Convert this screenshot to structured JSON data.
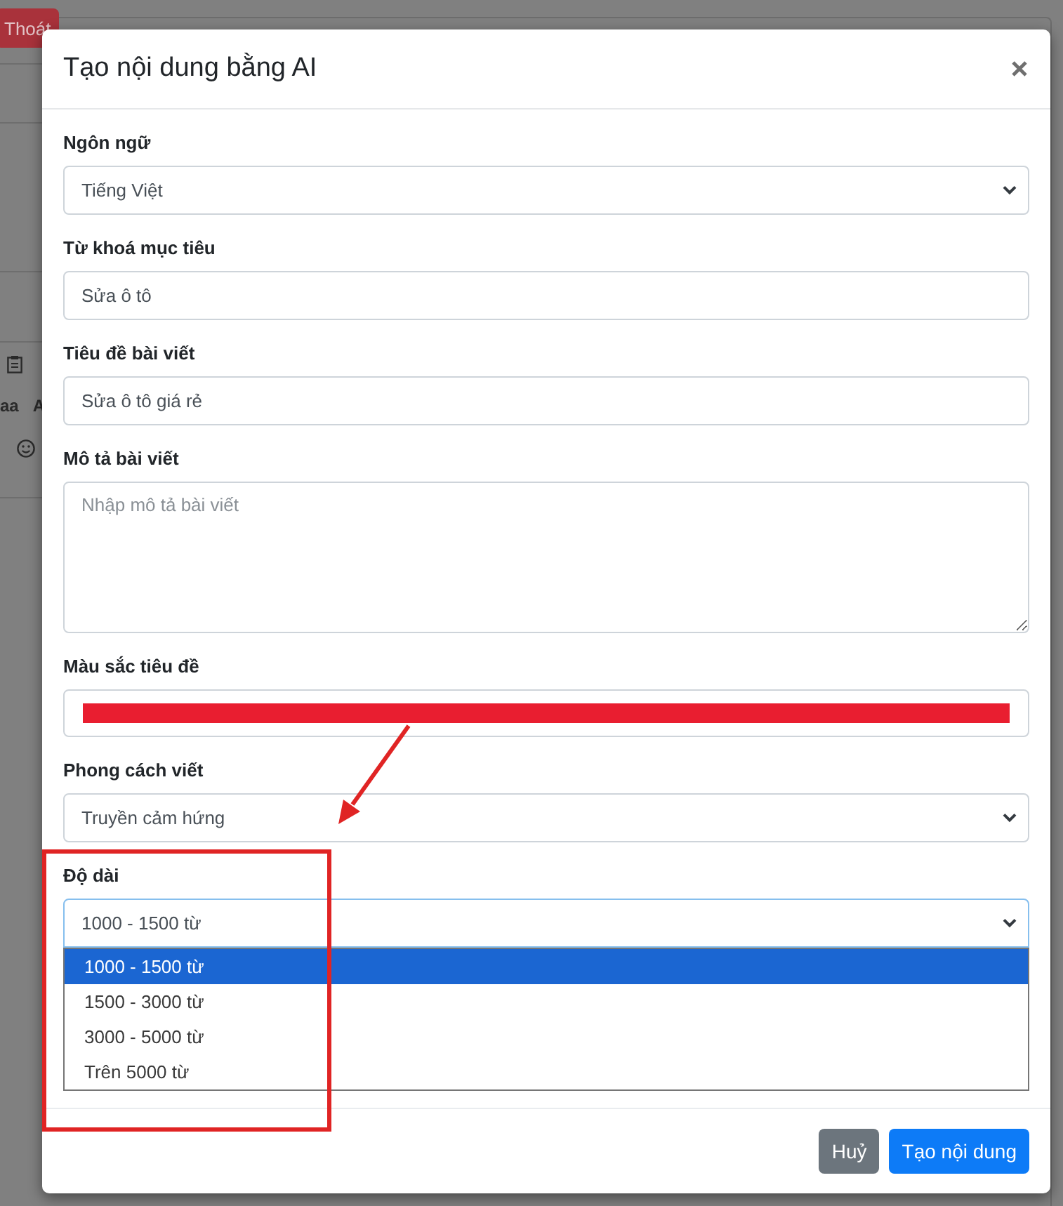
{
  "background": {
    "logout_button": "Thoát",
    "toolbar_texts": [
      "aa",
      "A"
    ]
  },
  "dialog": {
    "title": "Tạo nội dung bằng AI"
  },
  "fields": [
    {
      "kind": "select",
      "label": "Ngôn ngữ",
      "value": "Tiếng Việt",
      "expanded": false
    },
    {
      "kind": "text",
      "label": "Từ khoá mục tiêu",
      "value": "Sửa ô tô"
    },
    {
      "kind": "text",
      "label": "Tiêu đề bài viết",
      "value": "Sửa ô tô giá rẻ"
    },
    {
      "kind": "textarea",
      "label": "Mô tả bài viết",
      "placeholder": "Nhập mô tả bài viết"
    },
    {
      "kind": "color",
      "label": "Màu sắc tiêu đề",
      "color": "#e91e30"
    },
    {
      "kind": "select",
      "label": "Phong cách viết",
      "value": "Truyền cảm hứng",
      "expanded": false
    },
    {
      "kind": "select",
      "label": "Độ dài",
      "value": "1000 - 1500 từ",
      "expanded": true,
      "options": [
        {
          "label": "1000 - 1500 từ",
          "selected": true
        },
        {
          "label": "1500 - 3000 từ",
          "selected": false
        },
        {
          "label": "3000 - 5000 từ",
          "selected": false
        },
        {
          "label": "Trên 5000 từ",
          "selected": false
        }
      ]
    }
  ],
  "buttons": [
    {
      "kind": "secondary",
      "label": "Huỷ"
    },
    {
      "kind": "primary",
      "label": "Tạo nội dung"
    }
  ]
}
